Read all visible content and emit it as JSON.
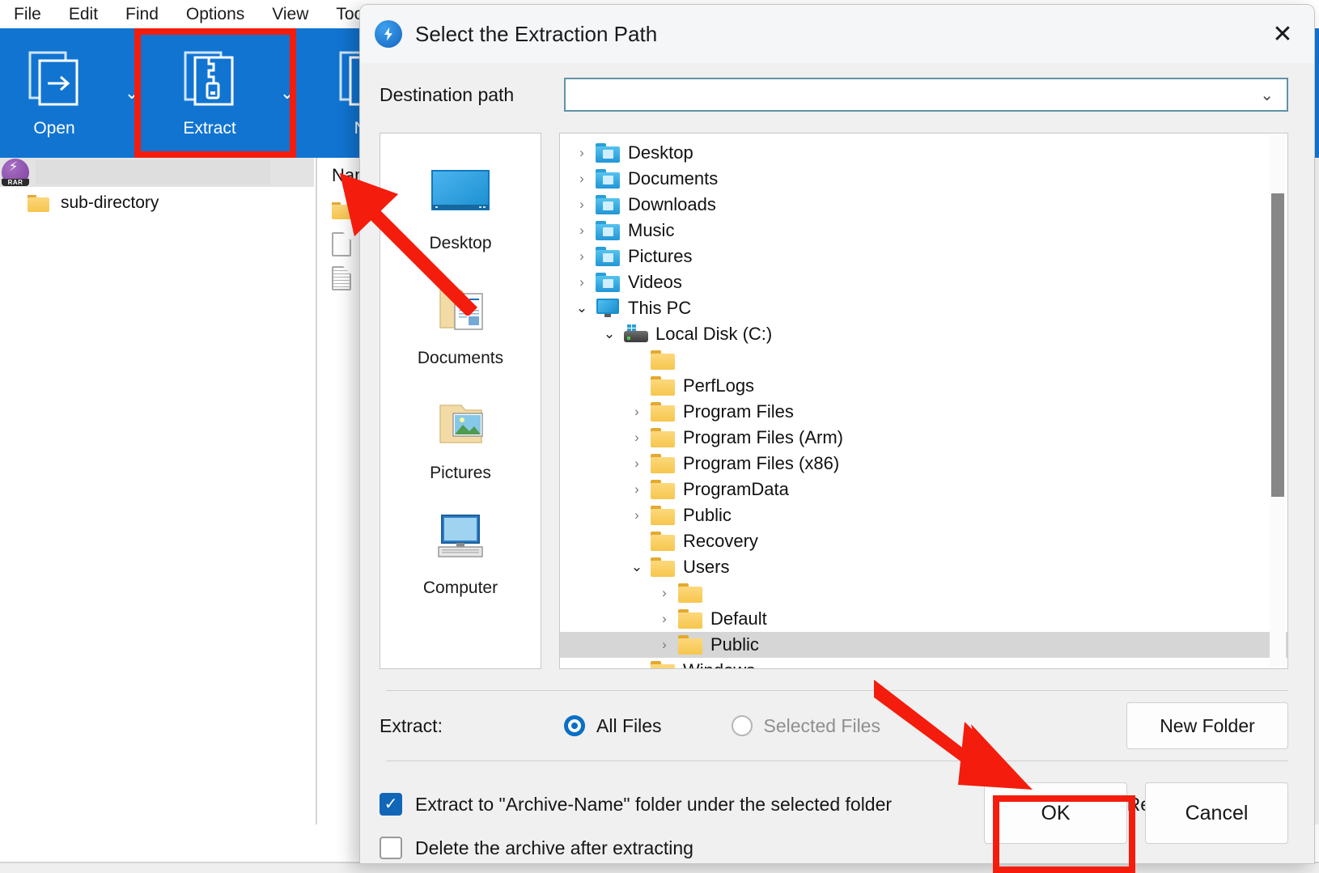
{
  "background_window": {
    "menu": [
      {
        "label": "File"
      },
      {
        "label": "Edit"
      },
      {
        "label": "Find"
      },
      {
        "label": "Options"
      },
      {
        "label": "View"
      },
      {
        "label": "Too"
      }
    ],
    "toolbar": [
      {
        "label": "Open",
        "icon": "open-archive-icon"
      },
      {
        "label": "Extract",
        "icon": "extract-zipper-icon"
      },
      {
        "label": "Ne",
        "icon": "new-archive-icon"
      }
    ],
    "address_badge": "RAR",
    "address_value": "",
    "left_items": [
      {
        "label": "sub-directory",
        "icon": "folder-icon"
      }
    ],
    "column_header": "Nam",
    "file_rows": [
      {
        "label": "",
        "icon": "folder-icon"
      },
      {
        "label": "",
        "icon": "document-icon"
      },
      {
        "label": "",
        "icon": "text-document-icon"
      }
    ]
  },
  "dialog": {
    "title": "Select the Extraction Path",
    "app_icon": "bandizip-bolt-icon",
    "close_label": "✕",
    "destination": {
      "label": "Destination path",
      "value": "",
      "placeholder": "",
      "caret": "⌄"
    },
    "places": [
      {
        "label": "Desktop",
        "icon": "desktop-monitor-icon"
      },
      {
        "label": "Documents",
        "icon": "documents-folder-icon"
      },
      {
        "label": "Pictures",
        "icon": "pictures-folder-icon"
      },
      {
        "label": "Computer",
        "icon": "computer-monitor-icon"
      }
    ],
    "tree": [
      {
        "label": "Desktop",
        "icon": "blue-folder-desktop-icon",
        "indent": 0,
        "twist": "collapsed",
        "selected": false
      },
      {
        "label": "Documents",
        "icon": "blue-folder-documents-icon",
        "indent": 0,
        "twist": "collapsed",
        "selected": false
      },
      {
        "label": "Downloads",
        "icon": "blue-folder-downloads-icon",
        "indent": 0,
        "twist": "collapsed",
        "selected": false
      },
      {
        "label": "Music",
        "icon": "blue-folder-music-icon",
        "indent": 0,
        "twist": "collapsed",
        "selected": false
      },
      {
        "label": "Pictures",
        "icon": "blue-folder-pictures-icon",
        "indent": 0,
        "twist": "collapsed",
        "selected": false
      },
      {
        "label": "Videos",
        "icon": "blue-folder-videos-icon",
        "indent": 0,
        "twist": "collapsed",
        "selected": false
      },
      {
        "label": "This PC",
        "icon": "this-pc-monitor-icon",
        "indent": 0,
        "twist": "expanded",
        "selected": false
      },
      {
        "label": "Local Disk (C:)",
        "icon": "local-disk-icon",
        "indent": 1,
        "twist": "expanded",
        "selected": false
      },
      {
        "label": "",
        "icon": "yellow-folder-icon",
        "indent": 2,
        "twist": "none",
        "selected": false
      },
      {
        "label": "PerfLogs",
        "icon": "yellow-folder-icon",
        "indent": 2,
        "twist": "none",
        "selected": false
      },
      {
        "label": "Program Files",
        "icon": "yellow-folder-icon",
        "indent": 2,
        "twist": "collapsed",
        "selected": false
      },
      {
        "label": "Program Files (Arm)",
        "icon": "yellow-folder-icon",
        "indent": 2,
        "twist": "collapsed",
        "selected": false
      },
      {
        "label": "Program Files (x86)",
        "icon": "yellow-folder-icon",
        "indent": 2,
        "twist": "collapsed",
        "selected": false
      },
      {
        "label": "ProgramData",
        "icon": "yellow-folder-icon",
        "indent": 2,
        "twist": "collapsed",
        "selected": false
      },
      {
        "label": "Public",
        "icon": "yellow-folder-icon",
        "indent": 2,
        "twist": "collapsed",
        "selected": false
      },
      {
        "label": "Recovery",
        "icon": "yellow-folder-icon",
        "indent": 2,
        "twist": "none",
        "selected": false
      },
      {
        "label": "Users",
        "icon": "yellow-folder-icon",
        "indent": 2,
        "twist": "expanded",
        "selected": false
      },
      {
        "label": "",
        "icon": "yellow-folder-icon",
        "indent": 3,
        "twist": "collapsed",
        "selected": false
      },
      {
        "label": "Default",
        "icon": "yellow-folder-icon",
        "indent": 3,
        "twist": "collapsed",
        "selected": false
      },
      {
        "label": "Public",
        "icon": "yellow-folder-icon",
        "indent": 3,
        "twist": "collapsed",
        "selected": true
      },
      {
        "label": "Windows",
        "icon": "yellow-folder-icon",
        "indent": 2,
        "twist": "collapsed",
        "selected": false
      }
    ],
    "extract": {
      "label": "Extract:",
      "options": [
        {
          "label": "All Files",
          "selected": true,
          "disabled": false
        },
        {
          "label": "Selected Files",
          "selected": false,
          "disabled": true
        }
      ]
    },
    "new_folder_label": "New Folder",
    "checkboxes": [
      {
        "label": "Extract to \"Archive-Name\" folder under the selected folder",
        "checked": true
      },
      {
        "label": "Delete the archive after extracting",
        "checked": false
      }
    ],
    "remember": {
      "label": "Remember settings",
      "checked": false
    },
    "buttons": [
      {
        "label": "OK",
        "highlighted": true
      },
      {
        "label": "Cancel",
        "highlighted": false
      }
    ]
  },
  "annotations": {
    "highlight_color": "#f41c0c",
    "boxes": [
      {
        "name": "extract-toolbar-highlight"
      },
      {
        "name": "ok-button-highlight"
      }
    ],
    "arrows": [
      {
        "name": "arrow-to-extract-button"
      },
      {
        "name": "arrow-to-ok-button"
      }
    ]
  }
}
